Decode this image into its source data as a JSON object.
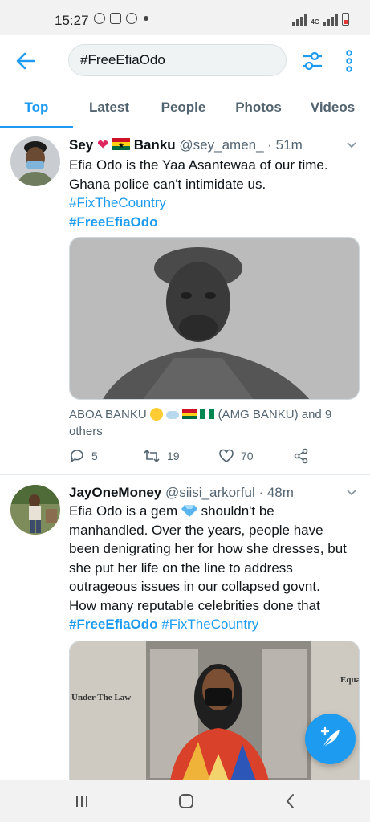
{
  "status_bar": {
    "time": "15:27",
    "network": "4G"
  },
  "search": {
    "query": "#FreeEfiaOdo"
  },
  "tabs": [
    {
      "label": "Top",
      "active": true
    },
    {
      "label": "Latest",
      "active": false
    },
    {
      "label": "People",
      "active": false
    },
    {
      "label": "Photos",
      "active": false
    },
    {
      "label": "Videos",
      "active": false
    }
  ],
  "tweets": [
    {
      "name_first": "Sey",
      "name_emoji": "❤",
      "name_last": "Banku",
      "handle": "@sey_amen_",
      "time": "· 51m",
      "text_1": "Efia Odo is the Yaa Asantewaa of our time.",
      "text_2": "Ghana police can't intimidate us.",
      "hashtag_1": "#FixTheCountry",
      "hashtag_2": "#FreeEfiaOdo",
      "tagged_1": "ABOA BANKU",
      "tagged_2": "(AMG BANKU) and 9",
      "tagged_3": "others",
      "replies": "5",
      "retweets": "19",
      "likes": "70"
    },
    {
      "name": "JayOneMoney",
      "handle": "@siisi_arkorful",
      "time": "· 48m",
      "line_1a": "Efia Odo is a gem",
      "line_1b": "shouldn't be",
      "line_2": "manhandled. Over the years, people have",
      "line_3": "been denigrating her for how she dresses, but",
      "line_4": "she put her life on the line to address",
      "line_5": "outrageous issues in our collapsed govnt.",
      "line_6": "How many reputable celebrities done that",
      "hashtag_1": "#FreeEfiaOdo",
      "hashtag_2": "#FixTheCountry",
      "building_sign_left": "Under The Law",
      "building_sign_right": "Equal"
    }
  ],
  "colors": {
    "accent": "#1d9bf0",
    "heart": "#e0245e"
  },
  "icons": {
    "back": "arrow-left-icon",
    "filter": "sliders-icon",
    "more": "dots-vertical-icon",
    "compose": "feather-plus-icon"
  }
}
